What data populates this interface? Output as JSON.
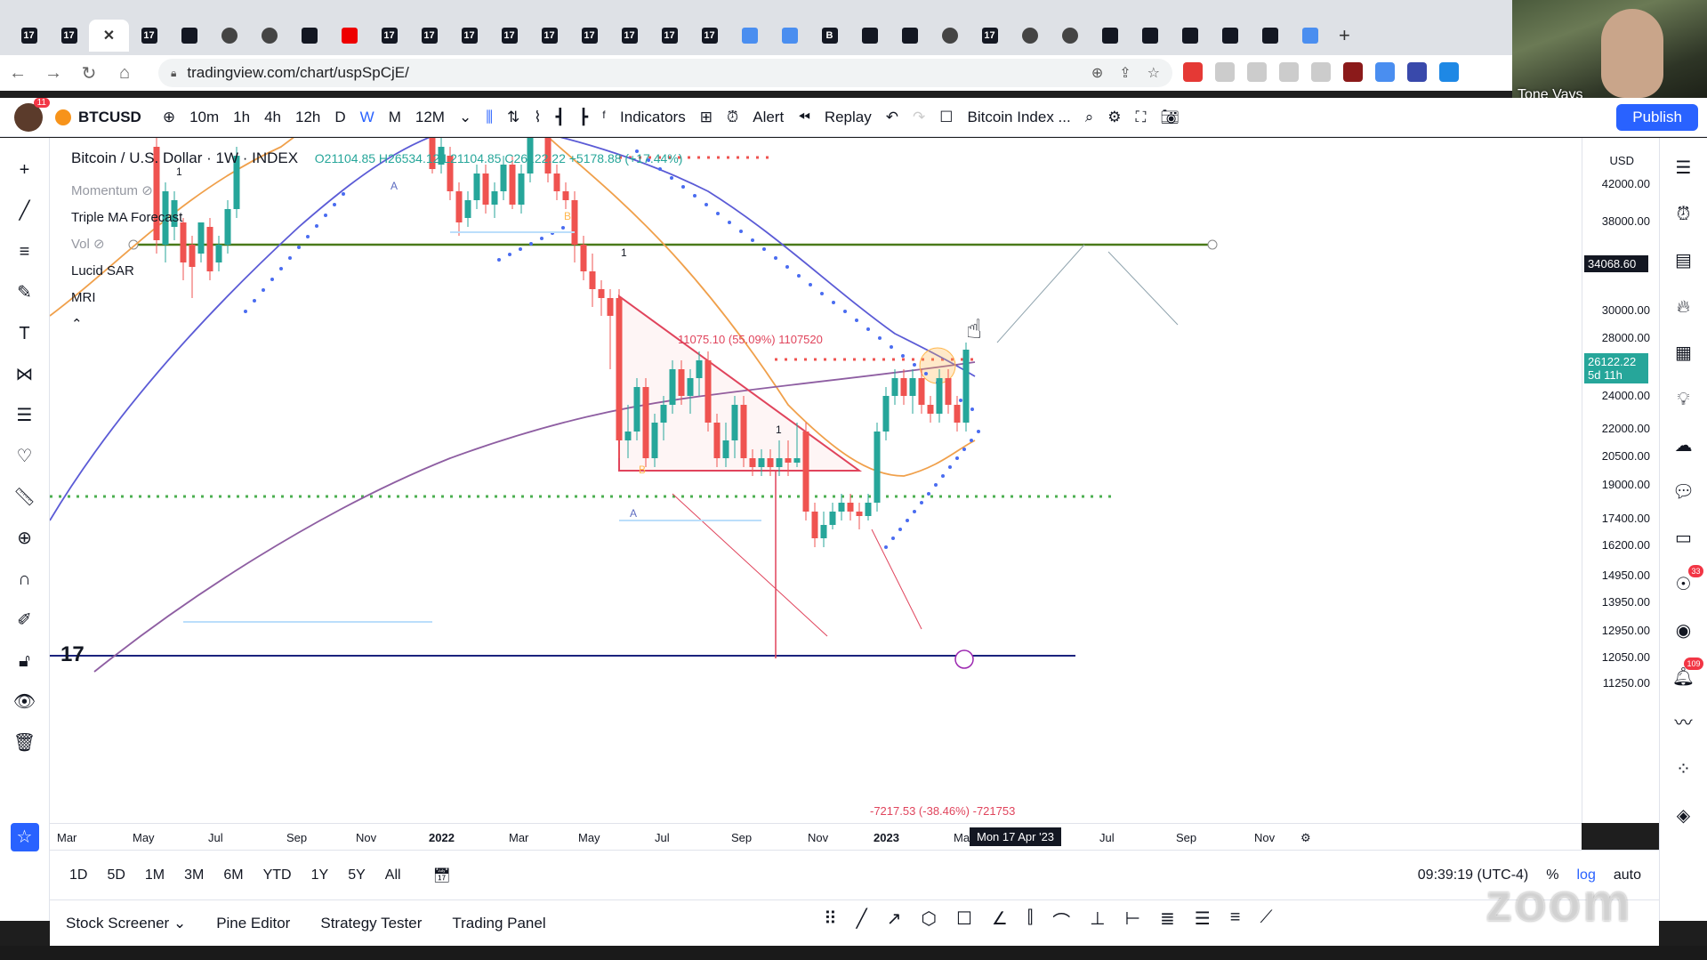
{
  "browser": {
    "url": "tradingview.com/chart/uspSpCjE/",
    "tab_favicons": [
      "TV",
      "TV",
      "x",
      "TV",
      "img",
      "glob",
      "glob",
      "wave",
      "yt",
      "TV",
      "TV",
      "TV",
      "TV",
      "TV",
      "TV",
      "TV",
      "TV",
      "TV",
      "cloud",
      "fb",
      "B",
      "eia",
      "eia",
      "compass",
      "TV",
      "a",
      "coin",
      "pen",
      "chart",
      "plus",
      "chart",
      "bird",
      "at"
    ],
    "new_tab": "+"
  },
  "webcam": {
    "name": "Tone Vays"
  },
  "toolbar": {
    "notification_count": "11",
    "symbol": "BTCUSD",
    "intervals": [
      "10m",
      "1h",
      "4h",
      "12h",
      "D",
      "W",
      "M",
      "12M"
    ],
    "active_interval": "W",
    "indicators_label": "Indicators",
    "alert_label": "Alert",
    "replay_label": "Replay",
    "compare_label": "Bitcoin Index ...",
    "publish_label": "Publish"
  },
  "legend": {
    "title": "Bitcoin / U.S. Dollar · 1W · INDEX",
    "ohlc": "O21104.85 H26534.12 L21104.85 C26122.22 +5178.88 (+17.44%)",
    "indicators": [
      {
        "name": "Momentum",
        "hidden": true
      },
      {
        "name": "Triple MA Forecast",
        "hidden": false
      },
      {
        "name": "Vol",
        "hidden": true
      },
      {
        "name": "Lucid SAR",
        "hidden": false
      },
      {
        "name": "MRI",
        "hidden": false
      }
    ]
  },
  "annotations": {
    "measure_top": "11075.10 (55.09%) 1107520",
    "measure_bottom": "-7217.53 (-38.46%) -721753",
    "wave_marks": [
      "1",
      "1",
      "A",
      "A",
      "B",
      "B",
      "1"
    ]
  },
  "price_axis": {
    "currency": "USD",
    "labels": [
      "42000.00",
      "38000.00",
      "34068.60",
      "30000.00",
      "28000.00",
      "26122.22",
      "24000.00",
      "22000.00",
      "20500.00",
      "19000.00",
      "17400.00",
      "16200.00",
      "14950.00",
      "13950.00",
      "12950.00",
      "12050.00",
      "11250.00"
    ],
    "horizontal_line_price": "34068.60",
    "last_price": "26122.22",
    "countdown": "5d 11h"
  },
  "time_axis": {
    "labels": [
      "Mar",
      "May",
      "Jul",
      "Sep",
      "Nov",
      "2022",
      "Mar",
      "May",
      "Jul",
      "Sep",
      "Nov",
      "2023",
      "Mar",
      "Jul",
      "Sep",
      "Nov"
    ],
    "cursor_label": "Mon 17 Apr '23"
  },
  "range_bar": {
    "ranges": [
      "1D",
      "5D",
      "1M",
      "3M",
      "6M",
      "YTD",
      "1Y",
      "5Y",
      "All"
    ],
    "clock": "09:39:19 (UTC-4)",
    "pct": "%",
    "log": "log",
    "auto": "auto"
  },
  "bottom_panel": {
    "tabs": [
      "Stock Screener",
      "Pine Editor",
      "Strategy Tester",
      "Trading Panel"
    ]
  },
  "right_badges": {
    "ideas": "33",
    "notifications": "109"
  },
  "colors": {
    "up": "#26a69a",
    "down": "#ef5350",
    "ma_blue": "#5b5bd6",
    "ma_orange": "#f0a04b",
    "ma_purple": "#8e5ea2",
    "green_line": "#4a7a1a",
    "sar_blue": "#2962ff",
    "accent": "#2962ff"
  }
}
